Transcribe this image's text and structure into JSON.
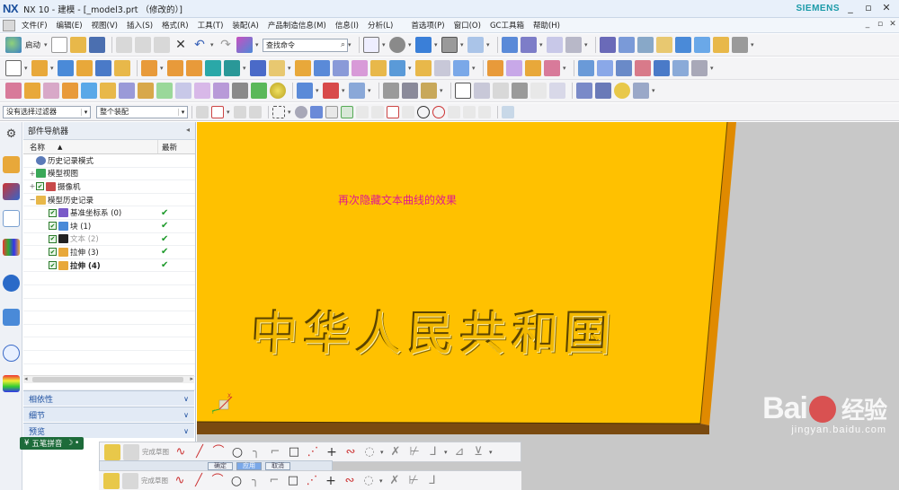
{
  "window": {
    "title": "NX 10 - 建模 - [_model3.prt （修改的）]",
    "brand": "SIEMENS",
    "logo": "NX"
  },
  "menu": {
    "items": [
      "文件(F)",
      "编辑(E)",
      "视图(V)",
      "插入(S)",
      "格式(R)",
      "工具(T)",
      "装配(A)",
      "产品制造信息(M)",
      "信息(I)",
      "分析(L)",
      "首选项(P)",
      "窗口(O)",
      "GC工具箱",
      "帮助(H)"
    ]
  },
  "toolbar": {
    "start_label": "启动",
    "command_search_placeholder": "查找命令"
  },
  "filterbar": {
    "selection_filter": "没有选择过滤器",
    "assembly_scope": "整个装配"
  },
  "navigator": {
    "title": "部件导航器",
    "columns": {
      "name": "名称",
      "latest": "最新"
    },
    "rows": [
      {
        "label": "历史记录模式",
        "indent": 0,
        "expander": "",
        "check": false,
        "latest": false,
        "style": "normal"
      },
      {
        "label": "模型视图",
        "indent": 0,
        "expander": "+",
        "check": false,
        "latest": false,
        "style": "normal"
      },
      {
        "label": "摄像机",
        "indent": 0,
        "expander": "+",
        "check": true,
        "latest": false,
        "style": "normal"
      },
      {
        "label": "模型历史记录",
        "indent": 0,
        "expander": "−",
        "check": false,
        "latest": false,
        "style": "normal"
      },
      {
        "label": "基准坐标系 (0)",
        "indent": 1,
        "expander": "",
        "check": true,
        "latest": true,
        "style": "normal"
      },
      {
        "label": "块 (1)",
        "indent": 1,
        "expander": "",
        "check": true,
        "latest": true,
        "style": "normal"
      },
      {
        "label": "文本 (2)",
        "indent": 1,
        "expander": "",
        "check": true,
        "latest": true,
        "style": "muted"
      },
      {
        "label": "拉伸 (3)",
        "indent": 1,
        "expander": "",
        "check": true,
        "latest": true,
        "style": "normal"
      },
      {
        "label": "拉伸 (4)",
        "indent": 1,
        "expander": "",
        "check": true,
        "latest": true,
        "style": "bold"
      }
    ],
    "sections": [
      "相依性",
      "细节",
      "预览"
    ]
  },
  "graphics": {
    "caption": "再次隐藏文本曲线的效果",
    "embossed_text": "中华人民共和国",
    "triad_x": "X",
    "triad_y": "Y"
  },
  "ime": {
    "label": "五笔拼音"
  },
  "sketch": {
    "finish_label": "完成草图",
    "dialog_buttons": [
      "确定",
      "应用",
      "取消"
    ]
  },
  "watermark": {
    "main": "Bai",
    "main_tail": "经验",
    "sub": "jingyan.baidu.com"
  },
  "colors": {
    "part_face": "#ffc100",
    "part_side": "#e08a00",
    "background": "#c8c8c8",
    "caption": "#e0198f",
    "check_green": "#1d9a2a"
  }
}
